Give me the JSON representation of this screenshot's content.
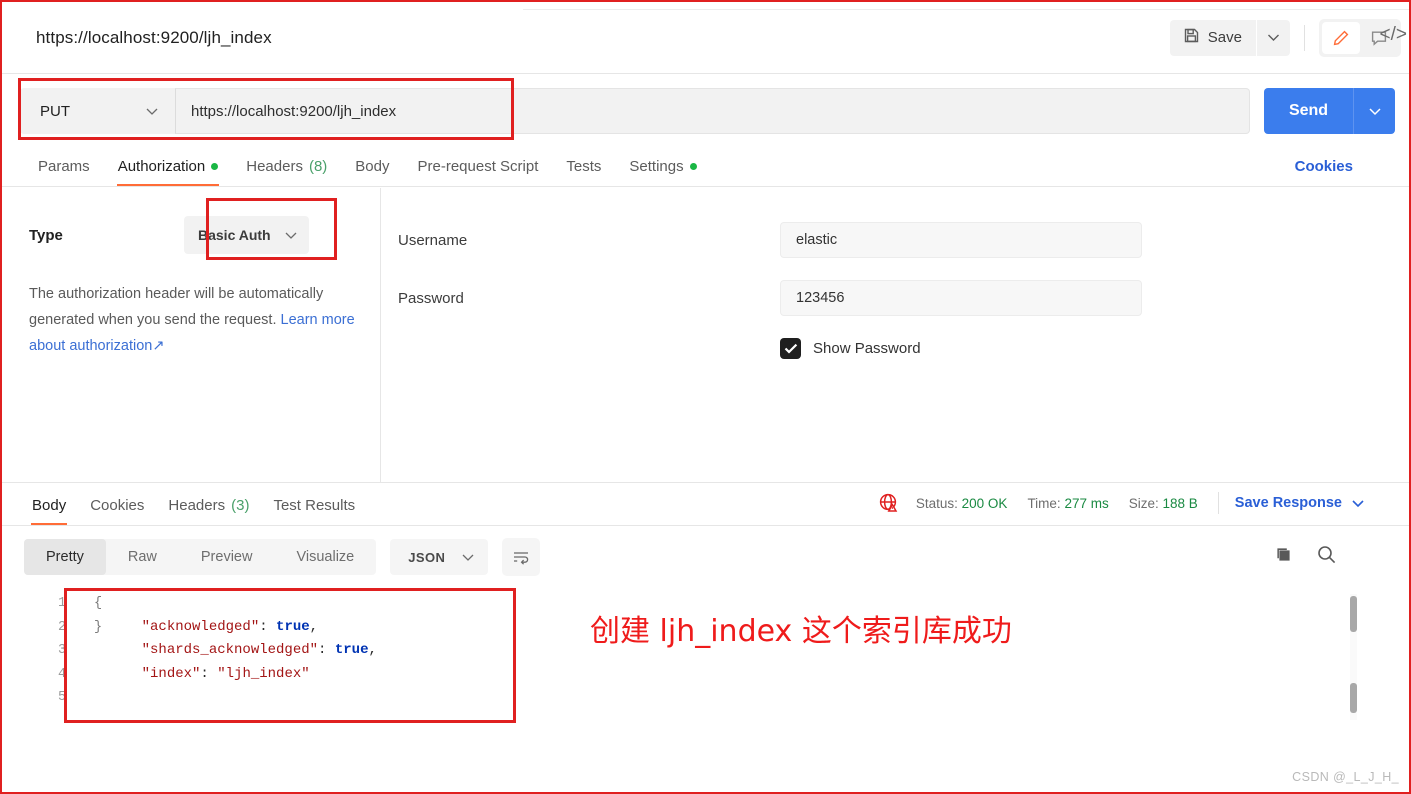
{
  "window": {
    "request_title": "https://localhost:9200/ljh_index",
    "code_icon": "</>"
  },
  "toolbar": {
    "save_label": "Save",
    "save_icon": "floppy-disk-icon",
    "save_caret_icon": "chevron-down-icon",
    "edit_icon": "pencil-icon",
    "comment_icon": "comment-icon",
    "accent_orange": "#ff6c37"
  },
  "url_bar": {
    "method": "PUT",
    "method_caret_icon": "chevron-down-icon",
    "url": "https://localhost:9200/ljh_index",
    "send_label": "Send",
    "send_caret_icon": "chevron-down-icon",
    "send_color": "#3b7ded"
  },
  "request_tabs": {
    "items": [
      {
        "label": "Params",
        "badge": "",
        "dot": false,
        "active": false
      },
      {
        "label": "Authorization",
        "badge": "",
        "dot": true,
        "active": true
      },
      {
        "label": "Headers",
        "badge": "(8)",
        "dot": false,
        "active": false
      },
      {
        "label": "Body",
        "badge": "",
        "dot": false,
        "active": false
      },
      {
        "label": "Pre-request Script",
        "badge": "",
        "dot": false,
        "active": false
      },
      {
        "label": "Tests",
        "badge": "",
        "dot": false,
        "active": false
      },
      {
        "label": "Settings",
        "badge": "",
        "dot": true,
        "active": false
      }
    ],
    "cookies_link": "Cookies",
    "dot_color": "#1ab744"
  },
  "authorization": {
    "type_label": "Type",
    "type_value": "Basic Auth",
    "type_caret_icon": "chevron-down-icon",
    "description_part1": "The authorization header will be automatically generated when you send the request. ",
    "learn_more_link": "Learn more about authorization",
    "learn_more_icon": "↗",
    "username_label": "Username",
    "username_value": "elastic",
    "password_label": "Password",
    "password_value": "123456",
    "show_password_label": "Show Password",
    "show_password_checked": true
  },
  "response_tabs": {
    "items": [
      {
        "label": "Body",
        "badge": "",
        "active": true
      },
      {
        "label": "Cookies",
        "badge": "",
        "active": false
      },
      {
        "label": "Headers",
        "badge": "(3)",
        "active": false
      },
      {
        "label": "Test Results",
        "badge": "",
        "active": false
      }
    ]
  },
  "response_meta": {
    "globe_icon": "globe-warning-icon",
    "status_label": "Status:",
    "status_value": "200 OK",
    "time_label": "Time:",
    "time_value": "277 ms",
    "size_label": "Size:",
    "size_value": "188 B",
    "save_response_label": "Save Response",
    "save_response_caret_icon": "chevron-down-icon",
    "value_color": "#1a8a42"
  },
  "response_toolbar": {
    "views": [
      {
        "label": "Pretty",
        "active": true
      },
      {
        "label": "Raw",
        "active": false
      },
      {
        "label": "Preview",
        "active": false
      },
      {
        "label": "Visualize",
        "active": false
      }
    ],
    "format": "JSON",
    "format_caret_icon": "chevron-down-icon",
    "wrap_icon": "word-wrap-icon",
    "copy_icon": "copy-icon",
    "search_icon": "search-icon"
  },
  "response_body": {
    "line_numbers": [
      "1",
      "2",
      "3",
      "4",
      "5"
    ],
    "fold_markers": [
      "{",
      "",
      "",
      "",
      "}"
    ],
    "lines": [
      {
        "indent": 0,
        "segments": []
      },
      {
        "indent": 1,
        "segments": [
          {
            "text": "\"acknowledged\"",
            "type": "key"
          },
          {
            "text": ": ",
            "type": "punct"
          },
          {
            "text": "true",
            "type": "bool"
          },
          {
            "text": ",",
            "type": "punct"
          }
        ]
      },
      {
        "indent": 1,
        "segments": [
          {
            "text": "\"shards_acknowledged\"",
            "type": "key"
          },
          {
            "text": ": ",
            "type": "punct"
          },
          {
            "text": "true",
            "type": "bool"
          },
          {
            "text": ",",
            "type": "punct"
          }
        ]
      },
      {
        "indent": 1,
        "segments": [
          {
            "text": "\"index\"",
            "type": "key"
          },
          {
            "text": ": ",
            "type": "punct"
          },
          {
            "text": "\"ljh_index\"",
            "type": "string"
          }
        ]
      },
      {
        "indent": 0,
        "segments": []
      }
    ]
  },
  "annotation": {
    "text": "创建 ljh_index 这个索引库成功",
    "color": "#ef1b1b"
  },
  "watermark": "CSDN @_L_J_H_"
}
